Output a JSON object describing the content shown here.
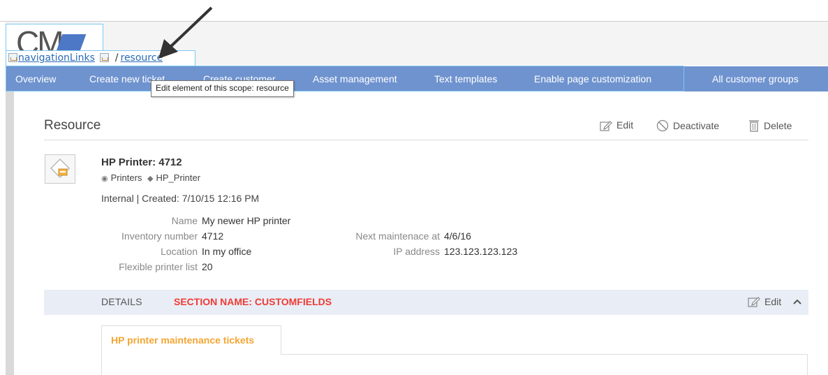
{
  "logo": {
    "text": "CM"
  },
  "scope_breadcrumb": {
    "root_link": "navigationLinks",
    "separator": "/",
    "current_link": "resource"
  },
  "nav": {
    "items": [
      {
        "label": "Overview"
      },
      {
        "label": "Create new ticket"
      },
      {
        "label": "Create customer"
      },
      {
        "label": "Asset management"
      },
      {
        "label": "Text templates"
      },
      {
        "label": "Enable page customization"
      },
      {
        "label": "All customer groups"
      }
    ],
    "color": "#6f93cf"
  },
  "tooltip": {
    "text": "Edit element of this scope: resource"
  },
  "page": {
    "title": "Resource",
    "actions": {
      "edit": "Edit",
      "deactivate": "Deactivate",
      "delete": "Delete"
    }
  },
  "resource": {
    "title": "HP Printer: 4712",
    "category": "Printers",
    "type": "HP_Printer",
    "meta": "Internal | Created: 7/10/15 12:16 PM",
    "fields_left": [
      {
        "label": "Name",
        "value": "My newer HP printer"
      },
      {
        "label": "Inventory number",
        "value": "4712"
      },
      {
        "label": "Location",
        "value": "In my office"
      },
      {
        "label": "Flexible printer list",
        "value": "20"
      }
    ],
    "fields_right": [
      {
        "label": "Next maintenace at",
        "value": "4/6/16"
      },
      {
        "label": "IP address",
        "value": "123.123.123.123"
      }
    ]
  },
  "details": {
    "label": "DETAILS",
    "section_name": "SECTION NAME: CUSTOMFIELDS",
    "edit": "Edit",
    "tab": "HP printer maintenance tickets",
    "accent": "#ef3b35",
    "tab_color": "#f3a533"
  }
}
